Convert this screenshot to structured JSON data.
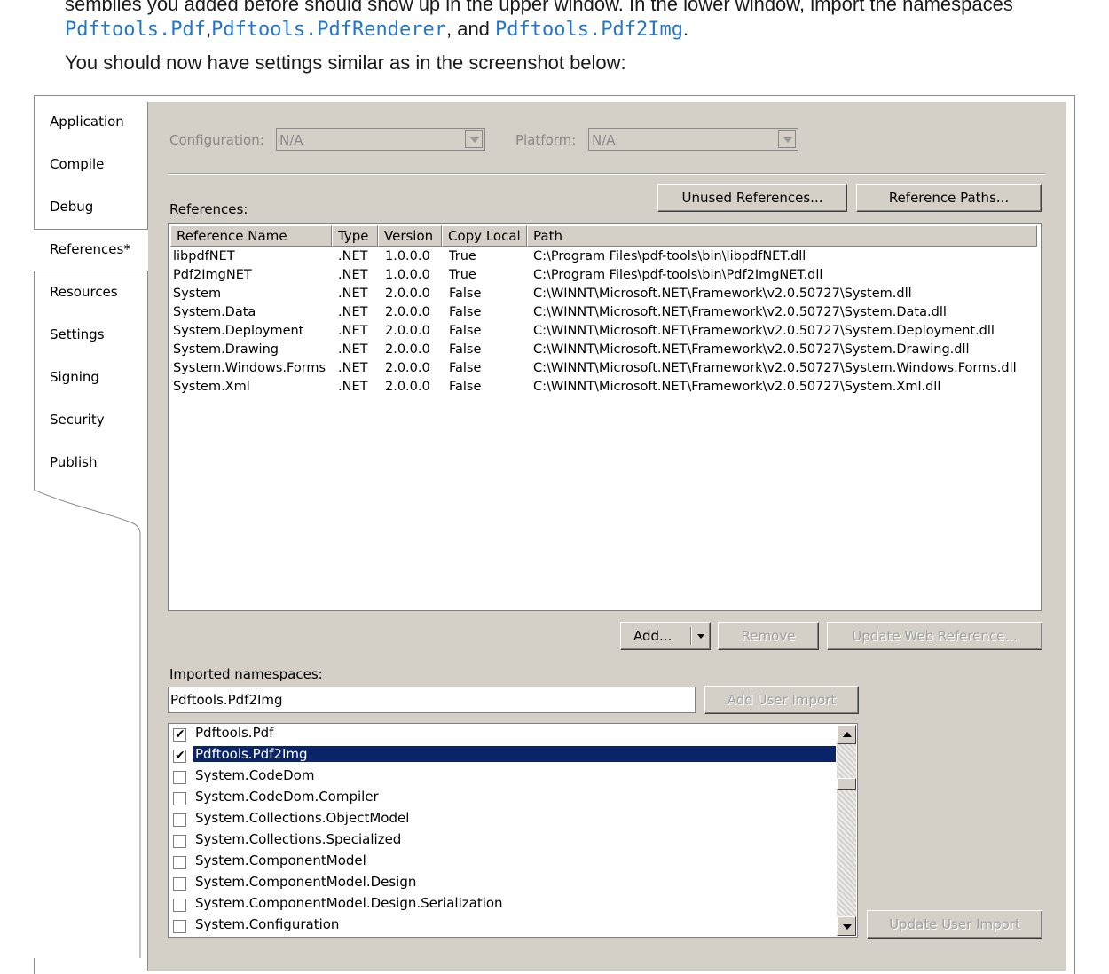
{
  "doc": {
    "line1": "semblies you added before should show up in the upper window. In the lower window, import the namespaces",
    "ns_pdf": "Pdftools.Pdf",
    "ns_renderer": "Pdftools.PdfRenderer",
    "sep_comma": ",",
    "sep_and": ", and",
    "ns_pdf2img": "Pdftools.Pdf2Img",
    "period": ".",
    "line3": "You should now have settings similar as in the screenshot below:"
  },
  "tabs": [
    "Application",
    "Compile",
    "Debug",
    "References*",
    "Resources",
    "Settings",
    "Signing",
    "Security",
    "Publish"
  ],
  "active_tab": "References*",
  "config": {
    "label": "Configuration:",
    "value": "N/A"
  },
  "platform": {
    "label": "Platform:",
    "value": "N/A"
  },
  "buttons": {
    "unused": "Unused References...",
    "paths": "Reference Paths...",
    "add": "Add...",
    "remove": "Remove",
    "update_web": "Update Web Reference...",
    "add_user_import": "Add User Import",
    "update_user_import": "Update User Import"
  },
  "references_label": "References:",
  "references": {
    "columns": [
      "Reference Name",
      "Type",
      "Version",
      "Copy Local",
      "Path"
    ],
    "rows": [
      [
        "libpdfNET",
        ".NET",
        "1.0.0.0",
        "True",
        "C:\\Program Files\\pdf-tools\\bin\\libpdfNET.dll"
      ],
      [
        "Pdf2ImgNET",
        ".NET",
        "1.0.0.0",
        "True",
        "C:\\Program Files\\pdf-tools\\bin\\Pdf2ImgNET.dll"
      ],
      [
        "System",
        ".NET",
        "2.0.0.0",
        "False",
        "C:\\WINNT\\Microsoft.NET\\Framework\\v2.0.50727\\System.dll"
      ],
      [
        "System.Data",
        ".NET",
        "2.0.0.0",
        "False",
        "C:\\WINNT\\Microsoft.NET\\Framework\\v2.0.50727\\System.Data.dll"
      ],
      [
        "System.Deployment",
        ".NET",
        "2.0.0.0",
        "False",
        "C:\\WINNT\\Microsoft.NET\\Framework\\v2.0.50727\\System.Deployment.dll"
      ],
      [
        "System.Drawing",
        ".NET",
        "2.0.0.0",
        "False",
        "C:\\WINNT\\Microsoft.NET\\Framework\\v2.0.50727\\System.Drawing.dll"
      ],
      [
        "System.Windows.Forms",
        ".NET",
        "2.0.0.0",
        "False",
        "C:\\WINNT\\Microsoft.NET\\Framework\\v2.0.50727\\System.Windows.Forms.dll"
      ],
      [
        "System.Xml",
        ".NET",
        "2.0.0.0",
        "False",
        "C:\\WINNT\\Microsoft.NET\\Framework\\v2.0.50727\\System.Xml.dll"
      ]
    ]
  },
  "imported_label": "Imported namespaces:",
  "import_input": "Pdftools.Pdf2Img",
  "namespaces": [
    {
      "name": "Pdftools.Pdf",
      "checked": true,
      "selected": false
    },
    {
      "name": "Pdftools.Pdf2Img",
      "checked": true,
      "selected": true
    },
    {
      "name": "System.CodeDom",
      "checked": false,
      "selected": false
    },
    {
      "name": "System.CodeDom.Compiler",
      "checked": false,
      "selected": false
    },
    {
      "name": "System.Collections.ObjectModel",
      "checked": false,
      "selected": false
    },
    {
      "name": "System.Collections.Specialized",
      "checked": false,
      "selected": false
    },
    {
      "name": "System.ComponentModel",
      "checked": false,
      "selected": false
    },
    {
      "name": "System.ComponentModel.Design",
      "checked": false,
      "selected": false
    },
    {
      "name": "System.ComponentModel.Design.Serialization",
      "checked": false,
      "selected": false
    },
    {
      "name": "System.Configuration",
      "checked": false,
      "selected": false
    }
  ]
}
